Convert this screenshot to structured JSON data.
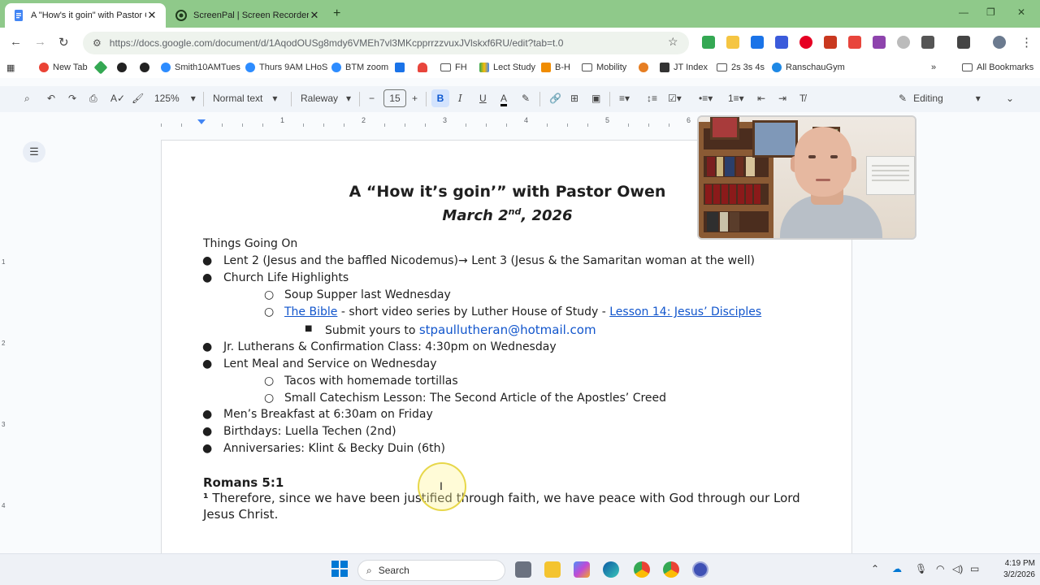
{
  "browser": {
    "tabs": [
      {
        "title": "A \"How's it goin\" with Pastor O",
        "active": true
      },
      {
        "title": "ScreenPal | Screen Recorder an",
        "active": false
      }
    ],
    "address": "https://docs.google.com/document/d/1AqodOUSg8mdy6VMEh7vl3MKcpprrzzvuxJVlskxf6RU/edit?tab=t.0"
  },
  "bookmarks": [
    {
      "label": "New Tab",
      "icon": "chrome-icon"
    },
    {
      "label": "",
      "icon": "green-diamond-icon"
    },
    {
      "label": "",
      "icon": "circle-icon"
    },
    {
      "label": "",
      "icon": "circle-icon-2"
    },
    {
      "label": "Smith10AMTues",
      "icon": "zoom-icon"
    },
    {
      "label": "Thurs 9AM LHoS",
      "icon": "zoom-icon"
    },
    {
      "label": "BTM zoom",
      "icon": "zoom-icon"
    },
    {
      "label": "",
      "icon": "shield-icon"
    },
    {
      "label": "",
      "icon": "headset-icon"
    },
    {
      "label": "FH",
      "icon": "folder-icon"
    },
    {
      "label": "Lect Study",
      "icon": "drive-icon"
    },
    {
      "label": "B-H",
      "icon": "shield-orange-icon"
    },
    {
      "label": "Mobility",
      "icon": "folder-icon"
    },
    {
      "label": "",
      "icon": "globe-icon"
    },
    {
      "label": "JT Index",
      "icon": "jt-icon"
    },
    {
      "label": "2s 3s 4s",
      "icon": "folder-icon"
    },
    {
      "label": "RanschauGym",
      "icon": "gym-icon"
    },
    {
      "label": "All Bookmarks",
      "icon": "folder-icon"
    }
  ],
  "docs_toolbar": {
    "zoom": "125%",
    "style": "Normal text",
    "font": "Raleway",
    "font_size": "15",
    "mode": "Editing"
  },
  "ruler": {
    "numbers": [
      "1",
      "2",
      "3",
      "4",
      "5",
      "6"
    ],
    "left_numbers": [
      "1",
      "2",
      "3",
      "4"
    ]
  },
  "document": {
    "title": "A “How it’s goin’” with Pastor Owen",
    "date_main": "March 2",
    "date_sup": "nd",
    "date_rest": ", 2026",
    "section_heading": "Things Going On",
    "items": {
      "lent": "Lent 2 (Jesus and the baffled Nicodemus)→ Lent 3 (Jesus & the Samaritan woman at the well)",
      "church_life": "Church Life Highlights",
      "soup": "Soup Supper last Wednesday",
      "bible_link": "The Bible",
      "bible_middle": " - short video series by Luther House of Study - ",
      "lesson_link": "Lesson 14: Jesus’ Disciples",
      "submit_prefix": "Submit yours to ",
      "submit_email": "stpaullutheran@hotmail.com",
      "jr_lutherans": "Jr. Lutherans & Confirmation Class: 4:30pm on Wednesday",
      "lent_meal": "Lent Meal and Service on Wednesday",
      "tacos": "Tacos with homemade tortillas",
      "catechism": "Small Catechism Lesson: The Second Article of the Apostles’ Creed",
      "mens": "Men’s Breakfast at 6:30am on Friday",
      "birthdays": "Birthdays: Luella Techen (2nd)",
      "anniversaries": "Anniversaries: Klint & Becky Duin (6th)"
    },
    "scripture_heading": "Romans 5:1",
    "verse_number": "¹",
    "verse_text_1": " Therefore, since we have been justified through faith, we have peace with God through our Lord",
    "verse_text_2": "Jesus Christ."
  },
  "taskbar": {
    "search_placeholder": "Search",
    "time": "4:19 PM",
    "date": "3/2/2026"
  },
  "colors": {
    "tabbar": "#8fc98a",
    "link": "#1155cc",
    "docs_toolbar": "#f0f4f9"
  }
}
